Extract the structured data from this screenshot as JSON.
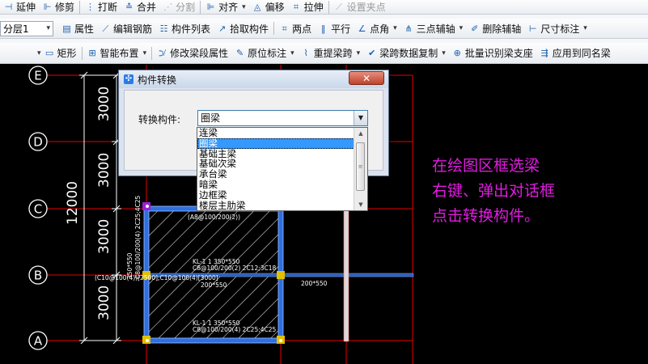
{
  "toolbar1": {
    "extend": "延伸",
    "trim": "修剪",
    "break": "打断",
    "merge": "合并",
    "split": "分割",
    "align": "对齐",
    "offset": "偏移",
    "stretch": "拉伸",
    "set_grip": "设置夹点"
  },
  "toolbar2": {
    "floor_select": "分层1",
    "property": "属性",
    "edit_rebar": "编辑钢筋",
    "component_list": "构件列表",
    "pick_component": "拾取构件",
    "two_point": "两点",
    "parallel": "平行",
    "point_angle": "点角",
    "three_point_axis": "三点辅轴",
    "delete_axis": "删除辅轴",
    "dimension": "尺寸标注"
  },
  "toolbar3": {
    "rectangle": "矩形",
    "smart_layout": "智能布置",
    "modify_beam_prop": "修改梁段属性",
    "origin_mark": "原位标注",
    "re_span": "重提梁跨",
    "copy_span_data": "梁跨数据复制",
    "batch_identify": "批量识别梁支座",
    "apply_same_name": "应用到同名梁"
  },
  "axes": {
    "labels": [
      "E",
      "D",
      "C",
      "B",
      "A"
    ],
    "spans": [
      "3000",
      "3000",
      "3000",
      "3000"
    ],
    "total": "12000"
  },
  "drawing_text": {
    "beam_lines": [
      "(A8@100/200(2))",
      "KL-1 1 350*550",
      "C8@100/200(2) 2C12;3C18",
      "(C10@100(4))[2500];C10@100(4)[3000]",
      "200*550",
      "200*550",
      "KL-1 1 350*550",
      "C8@100/200(4) 2C25;4C25",
      "350*550",
      "C8@100/200(4) 2C25;4C25"
    ]
  },
  "dialog": {
    "title": "构件转换",
    "close": "✕",
    "label": "转换构件:",
    "selected": "圈梁",
    "options": [
      "连梁",
      "圈梁",
      "基础主梁",
      "基础次梁",
      "承台梁",
      "暗梁",
      "边框梁",
      "楼层主肋梁"
    ]
  },
  "annotation": [
    "在绘图区框选梁",
    "右键、弹出对话框",
    "点击转换构件。"
  ],
  "colors": {
    "axis_line": "#e60000",
    "axis_bubble": "#ffffff",
    "beam": "#2f6fe0",
    "annotation": "#e11ce0",
    "selection_highlight": "#3399ff"
  }
}
